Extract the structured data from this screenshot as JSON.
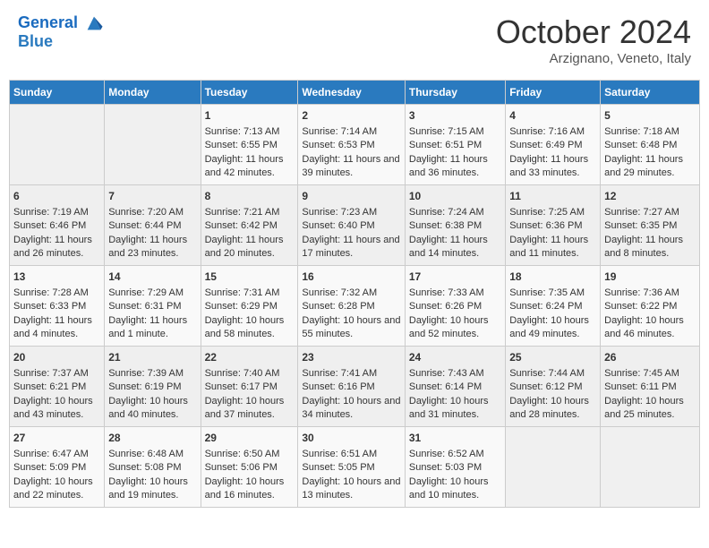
{
  "header": {
    "logo_line1": "General",
    "logo_line2": "Blue",
    "month": "October 2024",
    "location": "Arzignano, Veneto, Italy"
  },
  "days_of_week": [
    "Sunday",
    "Monday",
    "Tuesday",
    "Wednesday",
    "Thursday",
    "Friday",
    "Saturday"
  ],
  "weeks": [
    [
      {
        "day": "",
        "sunrise": "",
        "sunset": "",
        "daylight": ""
      },
      {
        "day": "",
        "sunrise": "",
        "sunset": "",
        "daylight": ""
      },
      {
        "day": "1",
        "sunrise": "Sunrise: 7:13 AM",
        "sunset": "Sunset: 6:55 PM",
        "daylight": "Daylight: 11 hours and 42 minutes."
      },
      {
        "day": "2",
        "sunrise": "Sunrise: 7:14 AM",
        "sunset": "Sunset: 6:53 PM",
        "daylight": "Daylight: 11 hours and 39 minutes."
      },
      {
        "day": "3",
        "sunrise": "Sunrise: 7:15 AM",
        "sunset": "Sunset: 6:51 PM",
        "daylight": "Daylight: 11 hours and 36 minutes."
      },
      {
        "day": "4",
        "sunrise": "Sunrise: 7:16 AM",
        "sunset": "Sunset: 6:49 PM",
        "daylight": "Daylight: 11 hours and 33 minutes."
      },
      {
        "day": "5",
        "sunrise": "Sunrise: 7:18 AM",
        "sunset": "Sunset: 6:48 PM",
        "daylight": "Daylight: 11 hours and 29 minutes."
      }
    ],
    [
      {
        "day": "6",
        "sunrise": "Sunrise: 7:19 AM",
        "sunset": "Sunset: 6:46 PM",
        "daylight": "Daylight: 11 hours and 26 minutes."
      },
      {
        "day": "7",
        "sunrise": "Sunrise: 7:20 AM",
        "sunset": "Sunset: 6:44 PM",
        "daylight": "Daylight: 11 hours and 23 minutes."
      },
      {
        "day": "8",
        "sunrise": "Sunrise: 7:21 AM",
        "sunset": "Sunset: 6:42 PM",
        "daylight": "Daylight: 11 hours and 20 minutes."
      },
      {
        "day": "9",
        "sunrise": "Sunrise: 7:23 AM",
        "sunset": "Sunset: 6:40 PM",
        "daylight": "Daylight: 11 hours and 17 minutes."
      },
      {
        "day": "10",
        "sunrise": "Sunrise: 7:24 AM",
        "sunset": "Sunset: 6:38 PM",
        "daylight": "Daylight: 11 hours and 14 minutes."
      },
      {
        "day": "11",
        "sunrise": "Sunrise: 7:25 AM",
        "sunset": "Sunset: 6:36 PM",
        "daylight": "Daylight: 11 hours and 11 minutes."
      },
      {
        "day": "12",
        "sunrise": "Sunrise: 7:27 AM",
        "sunset": "Sunset: 6:35 PM",
        "daylight": "Daylight: 11 hours and 8 minutes."
      }
    ],
    [
      {
        "day": "13",
        "sunrise": "Sunrise: 7:28 AM",
        "sunset": "Sunset: 6:33 PM",
        "daylight": "Daylight: 11 hours and 4 minutes."
      },
      {
        "day": "14",
        "sunrise": "Sunrise: 7:29 AM",
        "sunset": "Sunset: 6:31 PM",
        "daylight": "Daylight: 11 hours and 1 minute."
      },
      {
        "day": "15",
        "sunrise": "Sunrise: 7:31 AM",
        "sunset": "Sunset: 6:29 PM",
        "daylight": "Daylight: 10 hours and 58 minutes."
      },
      {
        "day": "16",
        "sunrise": "Sunrise: 7:32 AM",
        "sunset": "Sunset: 6:28 PM",
        "daylight": "Daylight: 10 hours and 55 minutes."
      },
      {
        "day": "17",
        "sunrise": "Sunrise: 7:33 AM",
        "sunset": "Sunset: 6:26 PM",
        "daylight": "Daylight: 10 hours and 52 minutes."
      },
      {
        "day": "18",
        "sunrise": "Sunrise: 7:35 AM",
        "sunset": "Sunset: 6:24 PM",
        "daylight": "Daylight: 10 hours and 49 minutes."
      },
      {
        "day": "19",
        "sunrise": "Sunrise: 7:36 AM",
        "sunset": "Sunset: 6:22 PM",
        "daylight": "Daylight: 10 hours and 46 minutes."
      }
    ],
    [
      {
        "day": "20",
        "sunrise": "Sunrise: 7:37 AM",
        "sunset": "Sunset: 6:21 PM",
        "daylight": "Daylight: 10 hours and 43 minutes."
      },
      {
        "day": "21",
        "sunrise": "Sunrise: 7:39 AM",
        "sunset": "Sunset: 6:19 PM",
        "daylight": "Daylight: 10 hours and 40 minutes."
      },
      {
        "day": "22",
        "sunrise": "Sunrise: 7:40 AM",
        "sunset": "Sunset: 6:17 PM",
        "daylight": "Daylight: 10 hours and 37 minutes."
      },
      {
        "day": "23",
        "sunrise": "Sunrise: 7:41 AM",
        "sunset": "Sunset: 6:16 PM",
        "daylight": "Daylight: 10 hours and 34 minutes."
      },
      {
        "day": "24",
        "sunrise": "Sunrise: 7:43 AM",
        "sunset": "Sunset: 6:14 PM",
        "daylight": "Daylight: 10 hours and 31 minutes."
      },
      {
        "day": "25",
        "sunrise": "Sunrise: 7:44 AM",
        "sunset": "Sunset: 6:12 PM",
        "daylight": "Daylight: 10 hours and 28 minutes."
      },
      {
        "day": "26",
        "sunrise": "Sunrise: 7:45 AM",
        "sunset": "Sunset: 6:11 PM",
        "daylight": "Daylight: 10 hours and 25 minutes."
      }
    ],
    [
      {
        "day": "27",
        "sunrise": "Sunrise: 6:47 AM",
        "sunset": "Sunset: 5:09 PM",
        "daylight": "Daylight: 10 hours and 22 minutes."
      },
      {
        "day": "28",
        "sunrise": "Sunrise: 6:48 AM",
        "sunset": "Sunset: 5:08 PM",
        "daylight": "Daylight: 10 hours and 19 minutes."
      },
      {
        "day": "29",
        "sunrise": "Sunrise: 6:50 AM",
        "sunset": "Sunset: 5:06 PM",
        "daylight": "Daylight: 10 hours and 16 minutes."
      },
      {
        "day": "30",
        "sunrise": "Sunrise: 6:51 AM",
        "sunset": "Sunset: 5:05 PM",
        "daylight": "Daylight: 10 hours and 13 minutes."
      },
      {
        "day": "31",
        "sunrise": "Sunrise: 6:52 AM",
        "sunset": "Sunset: 5:03 PM",
        "daylight": "Daylight: 10 hours and 10 minutes."
      },
      {
        "day": "",
        "sunrise": "",
        "sunset": "",
        "daylight": ""
      },
      {
        "day": "",
        "sunrise": "",
        "sunset": "",
        "daylight": ""
      }
    ]
  ]
}
